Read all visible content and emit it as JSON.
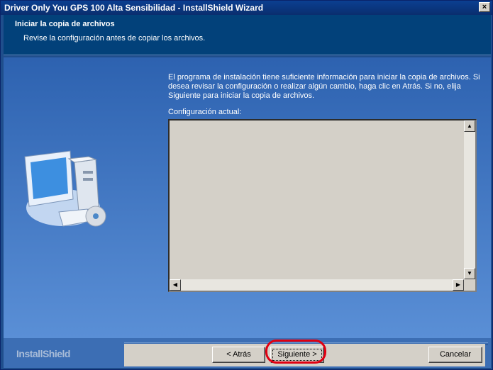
{
  "window": {
    "title": "Driver Only You GPS 100 Alta Sensibilidad - InstallShield Wizard",
    "close_glyph": "×"
  },
  "header": {
    "title": "Iniciar la copia de archivos",
    "subtitle": "Revise la configuración antes de copiar los archivos."
  },
  "body": {
    "description": "El programa de instalación tiene suficiente información para iniciar la copia de archivos.  Si desea revisar la configuración o realizar algún cambio, haga clic en Atrás.  Si no, elija Siguiente para iniciar la copia de archivos.",
    "config_label": "Configuración actual:",
    "config_value": ""
  },
  "footer": {
    "brand": "InstallShield",
    "back_label": "< Atrás",
    "next_label": "Siguiente >",
    "cancel_label": "Cancelar"
  },
  "colors": {
    "header_bg": "#02417a",
    "highlight": "#e00012",
    "titlebar": "#0a2e6e"
  }
}
